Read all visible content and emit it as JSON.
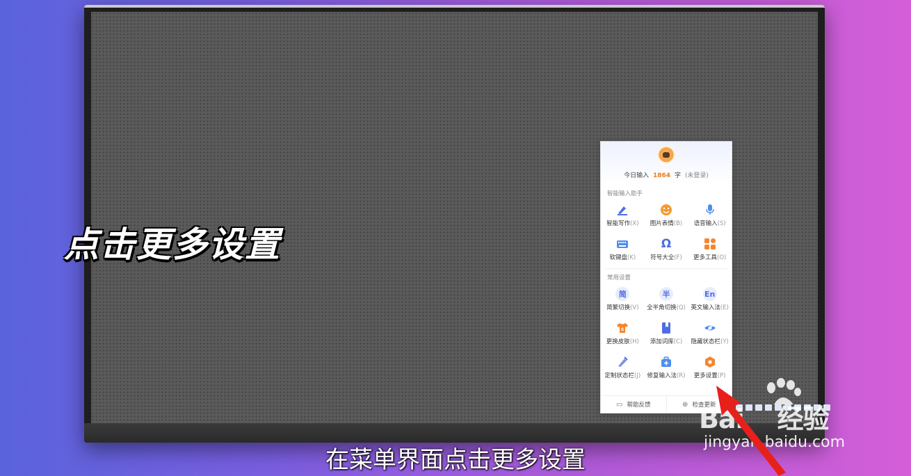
{
  "overlay": {
    "title": "点击更多设置",
    "subtitle": "在菜单界面点击更多设置"
  },
  "menu": {
    "today_prefix": "今日输入",
    "today_count": "1864",
    "today_unit": "字",
    "login_note": "(未登录)",
    "sections": [
      {
        "title": "智能输入助手",
        "items": [
          {
            "label": "智能写作",
            "shortcut": "(X)",
            "icon": "pen-icon",
            "color": "#4e6ee0"
          },
          {
            "label": "图片表情",
            "shortcut": "(B)",
            "icon": "smiley-icon",
            "color": "#f59a2e"
          },
          {
            "label": "语音输入",
            "shortcut": "(S)",
            "icon": "microphone-icon",
            "color": "#4e8ef0"
          },
          {
            "label": "软键盘",
            "shortcut": "(K)",
            "icon": "keyboard-icon",
            "color": "#4e8ef0"
          },
          {
            "label": "符号大全",
            "shortcut": "(F)",
            "icon": "omega-icon",
            "color": "#4e6ee0"
          },
          {
            "label": "更多工具",
            "shortcut": "(O)",
            "icon": "apps-icon",
            "color": "#f5862e"
          }
        ]
      },
      {
        "title": "常用设置",
        "items": [
          {
            "label": "简繁切换",
            "shortcut": "(V)",
            "icon": "simplified-icon",
            "glyph": "简"
          },
          {
            "label": "全半角切换",
            "shortcut": "(Q)",
            "icon": "halfwidth-icon",
            "glyph": "半"
          },
          {
            "label": "英文输入法",
            "shortcut": "(E)",
            "icon": "english-icon",
            "glyph": "En"
          },
          {
            "label": "更换皮肤",
            "shortcut": "(H)",
            "icon": "shirt-icon",
            "color": "#f5862e"
          },
          {
            "label": "添加词库",
            "shortcut": "(C)",
            "icon": "bookmark-icon",
            "color": "#4e6ee0"
          },
          {
            "label": "隐藏状态栏",
            "shortcut": "(Y)",
            "icon": "eye-hidden-icon",
            "color": "#4e8ef0"
          },
          {
            "label": "定制状态栏",
            "shortcut": "(J)",
            "icon": "brush-icon",
            "color": "#7a8ef0"
          },
          {
            "label": "修复输入法",
            "shortcut": "(R)",
            "icon": "toolbox-icon",
            "color": "#4e8ef0"
          },
          {
            "label": "更多设置",
            "shortcut": "(P)",
            "icon": "hex-gear-icon",
            "color": "#f5862e"
          }
        ]
      }
    ],
    "footer": {
      "feedback": "帮助反馈",
      "check_update": "检查更新"
    }
  },
  "watermark": {
    "brand_left": "Bai",
    "brand_right": "经验",
    "url": "jingyan.baidu.com"
  }
}
